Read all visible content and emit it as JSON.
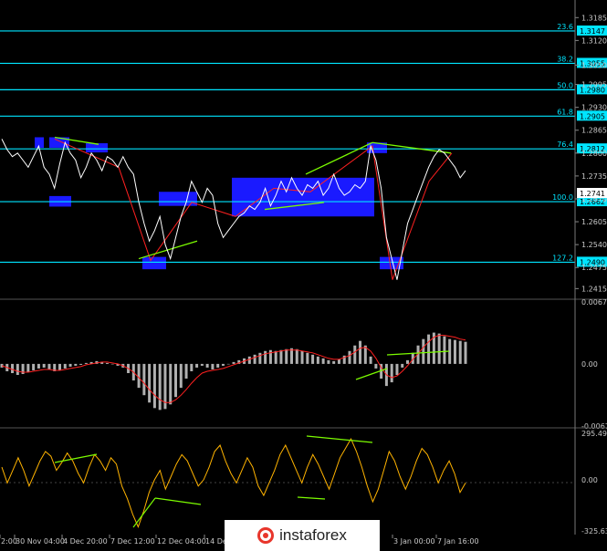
{
  "chart_data": [
    {
      "type": "line",
      "title": "",
      "xlabel": "",
      "ylabel": "",
      "ylim": [
        1.239,
        1.3235
      ],
      "y_ticks": [
        "1.3185",
        "1.3120",
        "1.3050",
        "1.2995",
        "1.2930",
        "1.2865",
        "1.2800",
        "1.2735",
        "1.2670",
        "1.2605",
        "1.2540",
        "1.2475",
        "1.2415"
      ],
      "x_ticks": [
        "2:00",
        "30 Nov 04:00",
        "4 Dec 20:00",
        "7 Dec 12:00",
        "12 Dec 04:00",
        "14 Dec",
        "3 Jan 00:00",
        "7 Jan 16:00"
      ],
      "price": [
        1.284,
        1.281,
        1.279,
        1.28,
        1.278,
        1.276,
        1.279,
        1.282,
        1.276,
        1.274,
        1.27,
        1.277,
        1.283,
        1.28,
        1.278,
        1.273,
        1.276,
        1.28,
        1.278,
        1.275,
        1.279,
        1.278,
        1.276,
        1.279,
        1.276,
        1.274,
        1.266,
        1.26,
        1.255,
        1.258,
        1.262,
        1.254,
        1.25,
        1.256,
        1.262,
        1.266,
        1.272,
        1.269,
        1.266,
        1.27,
        1.268,
        1.26,
        1.256,
        1.258,
        1.26,
        1.262,
        1.263,
        1.265,
        1.264,
        1.266,
        1.27,
        1.265,
        1.268,
        1.272,
        1.269,
        1.273,
        1.27,
        1.268,
        1.271,
        1.27,
        1.272,
        1.268,
        1.27,
        1.274,
        1.27,
        1.268,
        1.269,
        1.271,
        1.27,
        1.272,
        1.282,
        1.278,
        1.27,
        1.256,
        1.25,
        1.244,
        1.252,
        1.26,
        1.264,
        1.268,
        1.272,
        1.276,
        1.279,
        1.281,
        1.28,
        1.278,
        1.276,
        1.273,
        1.275
      ],
      "current_price": "1.2741",
      "levels": [
        {
          "fib": "23.6",
          "value": "1.3147"
        },
        {
          "fib": "38.2",
          "value": "1.3055"
        },
        {
          "fib": "50.0",
          "value": "1.2980"
        },
        {
          "fib": "61.8",
          "value": "1.2905"
        },
        {
          "fib": "76.4",
          "value": "1.2812"
        },
        {
          "fib": "100.0",
          "value": "1.2662"
        },
        {
          "fib": "127.2",
          "value": "1.2490"
        }
      ],
      "colors": {
        "level": "#00e5ff",
        "price": "#ffffff",
        "zigzag": "#ff2020",
        "divergence": "#7cfc00",
        "zone": "#1a1aff"
      }
    },
    {
      "type": "bar",
      "ylim": [
        -0.00675,
        0.00673
      ],
      "y_ticks": [
        "0.00673",
        "0.00",
        "-0.00675"
      ],
      "values": [
        -0.0004,
        -0.0008,
        -0.001,
        -0.0012,
        -0.0011,
        -0.0009,
        -0.0007,
        -0.0005,
        -0.0004,
        -0.0006,
        -0.0008,
        -0.0007,
        -0.0005,
        -0.0003,
        -0.0002,
        -0.0001,
        0.0001,
        0.0002,
        0.0003,
        0.0002,
        0.0001,
        0.0,
        -0.0002,
        -0.0004,
        -0.001,
        -0.0018,
        -0.0026,
        -0.0034,
        -0.0042,
        -0.0048,
        -0.005,
        -0.0049,
        -0.0044,
        -0.0036,
        -0.0026,
        -0.0016,
        -0.0008,
        -0.0004,
        -0.0002,
        -0.0004,
        -0.0006,
        -0.0004,
        -0.0002,
        0.0,
        0.0002,
        0.0004,
        0.0006,
        0.0008,
        0.001,
        0.0012,
        0.0014,
        0.0015,
        0.0014,
        0.0015,
        0.0016,
        0.0017,
        0.0016,
        0.0014,
        0.0012,
        0.001,
        0.0008,
        0.0006,
        0.0004,
        0.0003,
        0.0005,
        0.0009,
        0.0014,
        0.002,
        0.0025,
        0.002,
        0.0008,
        -0.0005,
        -0.0016,
        -0.0024,
        -0.002,
        -0.0012,
        -0.0004,
        0.0004,
        0.0012,
        0.002,
        0.0027,
        0.0032,
        0.0034,
        0.0033,
        0.003,
        0.0027,
        0.0026,
        0.0025,
        0.0024
      ],
      "signal": [
        -0.0002,
        -0.0004,
        -0.0006,
        -0.0008,
        -0.0009,
        -0.0009,
        -0.0008,
        -0.0007,
        -0.0006,
        -0.0006,
        -0.0007,
        -0.0007,
        -0.0006,
        -0.0005,
        -0.0004,
        -0.0003,
        -0.0001,
        0.0,
        0.0001,
        0.0002,
        0.0002,
        0.0001,
        0.0,
        -0.0002,
        -0.0005,
        -0.0009,
        -0.0015,
        -0.0021,
        -0.0028,
        -0.0034,
        -0.0039,
        -0.0042,
        -0.0042,
        -0.0039,
        -0.0034,
        -0.0028,
        -0.0021,
        -0.0015,
        -0.001,
        -0.0008,
        -0.0007,
        -0.0006,
        -0.0005,
        -0.0003,
        -0.0001,
        0.0001,
        0.0003,
        0.0005,
        0.0007,
        0.0009,
        0.0011,
        0.0012,
        0.0013,
        0.0014,
        0.0015,
        0.0015,
        0.0015,
        0.0014,
        0.0013,
        0.0012,
        0.001,
        0.0008,
        0.0006,
        0.0005,
        0.0005,
        0.0007,
        0.0009,
        0.0013,
        0.0017,
        0.0018,
        0.0014,
        0.0006,
        -0.0004,
        -0.0012,
        -0.0015,
        -0.0013,
        -0.0008,
        -0.0002,
        0.0005,
        0.0011,
        0.0018,
        0.0024,
        0.0029,
        0.0031,
        0.0031,
        0.003,
        0.0029,
        0.0027,
        0.0026
      ],
      "colors": {
        "bars": "#b0b0b0",
        "signal": "#ff2020",
        "divergence": "#7cfc00"
      }
    },
    {
      "type": "line",
      "ylim": [
        -325.63,
        295.4989
      ],
      "y_ticks": [
        "295.4989",
        "0.00",
        "-325.630"
      ],
      "values": [
        80,
        -20,
        60,
        140,
        60,
        -40,
        40,
        120,
        180,
        150,
        60,
        110,
        170,
        120,
        40,
        -20,
        80,
        160,
        120,
        60,
        140,
        100,
        -40,
        -120,
        -220,
        -300,
        -200,
        -80,
        0,
        60,
        -60,
        20,
        100,
        160,
        120,
        40,
        -40,
        0,
        80,
        180,
        220,
        120,
        40,
        -20,
        60,
        140,
        80,
        -40,
        -100,
        -20,
        60,
        160,
        220,
        140,
        60,
        -20,
        80,
        160,
        100,
        20,
        -60,
        40,
        140,
        200,
        260,
        180,
        80,
        -40,
        -140,
        -60,
        60,
        180,
        120,
        20,
        -60,
        20,
        120,
        200,
        160,
        80,
        -20,
        60,
        120,
        40,
        -80,
        -20
      ],
      "colors": {
        "line": "#ffb300",
        "divergence": "#7cfc00"
      }
    }
  ],
  "watermark": "instaforex"
}
